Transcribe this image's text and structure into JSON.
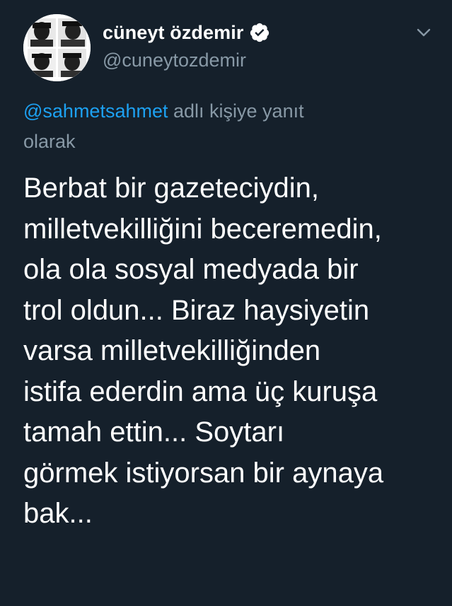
{
  "author": {
    "display_name": "cüneyt özdemir",
    "handle": "@cuneytozdemir",
    "verified": true,
    "verified_icon": "verified-badge-icon"
  },
  "menu": {
    "icon": "chevron-down-icon"
  },
  "reply": {
    "mention": "@sahmetsahmet",
    "suffix_line1": " adlı kişiye yanıt",
    "suffix_line2": "olarak"
  },
  "tweet": {
    "lines": [
      "Berbat bir gazeteciydin,",
      "milletvekilliğini beceremedin,",
      "ola ola sosyal medyada bir",
      "trol oldun... Biraz haysiyetin",
      "varsa milletvekilliğinden",
      "istifa ederdin ama üç kuruşa",
      "tamah ettin... Soytarı",
      "görmek istiyorsan bir aynaya",
      "bak..."
    ]
  },
  "colors": {
    "background": "#15202b",
    "primary_text": "#ffffff",
    "secondary_text": "#8899a6",
    "link": "#1da1f2"
  }
}
